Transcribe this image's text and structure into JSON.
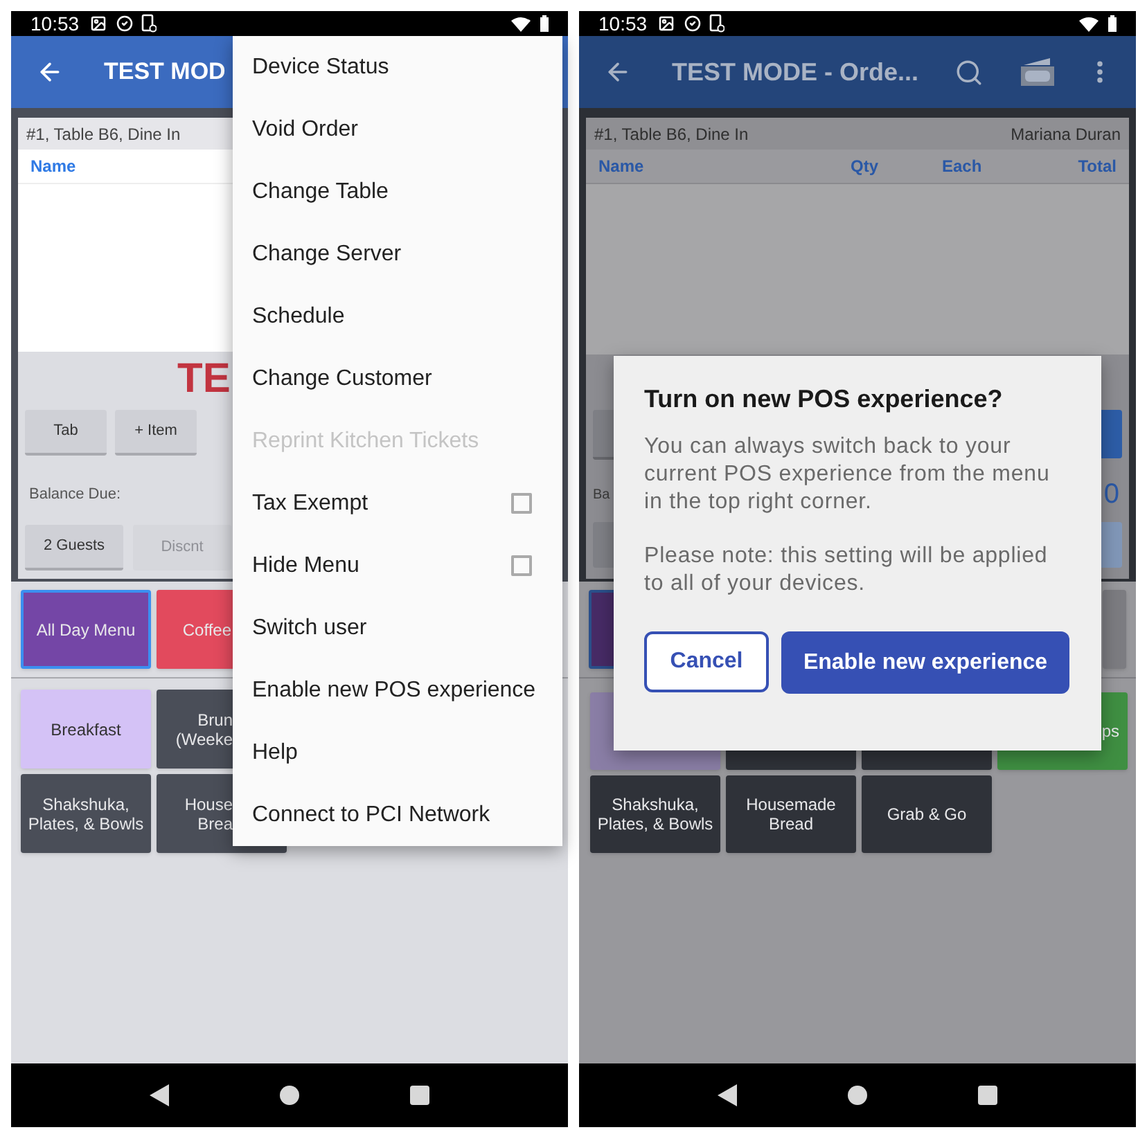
{
  "screens": [
    {
      "dimmed": false,
      "status_bar": {
        "time": "10:53"
      },
      "app_bar": {
        "title": "TEST MOD"
      },
      "order": {
        "header": "#1, Table B6, Dine In",
        "columns": [
          "Name"
        ],
        "banner": "TE",
        "action_buttons": [
          {
            "label": "Tab"
          },
          {
            "label": "+ Item"
          }
        ],
        "balance_label": "Balance Due:",
        "footer_buttons": [
          {
            "label": "2 Guests",
            "disabled": false
          },
          {
            "label": "Discnt",
            "disabled": true
          }
        ]
      },
      "categories": [
        {
          "label": "All Day Menu",
          "color": "#7446a6",
          "selected": true
        },
        {
          "label": "Coffee",
          "color": "#e24a5d",
          "selected": false
        }
      ],
      "tiles": [
        {
          "label": "Breakfast",
          "color": "#d4c2f6"
        },
        {
          "label": "Brun\n(Weeke",
          "color": "#4a4e58"
        },
        {
          "label": "Shakshuka,\nPlates, & Bowls",
          "color": "#4a4e58"
        },
        {
          "label": "House\nBrea",
          "color": "#4a4e58"
        }
      ],
      "menu": {
        "items": [
          {
            "label": "Device Status",
            "kind": "plain",
            "disabled": false
          },
          {
            "label": "Void Order",
            "kind": "plain",
            "disabled": false
          },
          {
            "label": "Change Table",
            "kind": "plain",
            "disabled": false
          },
          {
            "label": "Change Server",
            "kind": "plain",
            "disabled": false
          },
          {
            "label": "Schedule",
            "kind": "plain",
            "disabled": false
          },
          {
            "label": "Change Customer",
            "kind": "plain",
            "disabled": false
          },
          {
            "label": "Reprint Kitchen Tickets",
            "kind": "plain",
            "disabled": true
          },
          {
            "label": "Tax Exempt",
            "kind": "checkbox",
            "disabled": false,
            "checked": false
          },
          {
            "label": "Hide Menu",
            "kind": "checkbox",
            "disabled": false,
            "checked": false
          },
          {
            "label": "Switch user",
            "kind": "plain",
            "disabled": false
          },
          {
            "label": "Enable new POS experience",
            "kind": "plain",
            "disabled": false
          },
          {
            "label": "Help",
            "kind": "plain",
            "disabled": false
          },
          {
            "label": "Connect to PCI Network",
            "kind": "plain",
            "disabled": false
          }
        ]
      }
    },
    {
      "dimmed": true,
      "status_bar": {
        "time": "10:53"
      },
      "app_bar": {
        "title": "TEST MODE - Orde..."
      },
      "order": {
        "header": "#1, Table B6, Dine In",
        "customer": "Mariana Duran",
        "columns": [
          "Name",
          "Qty",
          "Each",
          "Total"
        ],
        "balance_label": "Ba",
        "balance_value": "0"
      },
      "categories": [
        {
          "color": "#472b66",
          "selected": true
        },
        {
          "color": "#7c7c81",
          "selected": false
        }
      ],
      "tiles": [
        {
          "color": "#8a7ea6"
        },
        {
          "color": "#2f3239"
        },
        {
          "color": "#2f3239"
        },
        {
          "label": "ps",
          "color": "#3f8f42"
        },
        {
          "label": "Shakshuka,\nPlates, & Bowls",
          "color": "#2f3239"
        },
        {
          "label": "Housemade\nBread",
          "color": "#2f3239"
        },
        {
          "label": "Grab & Go",
          "color": "#2f3239"
        }
      ],
      "dialog": {
        "title": "Turn on new POS experience?",
        "paragraphs": [
          "You can always switch back to your current POS experience from the menu in the top right corner.",
          "Please note: this setting will be applied to all of your devices."
        ],
        "cancel": "Cancel",
        "confirm": "Enable new experience"
      }
    }
  ]
}
